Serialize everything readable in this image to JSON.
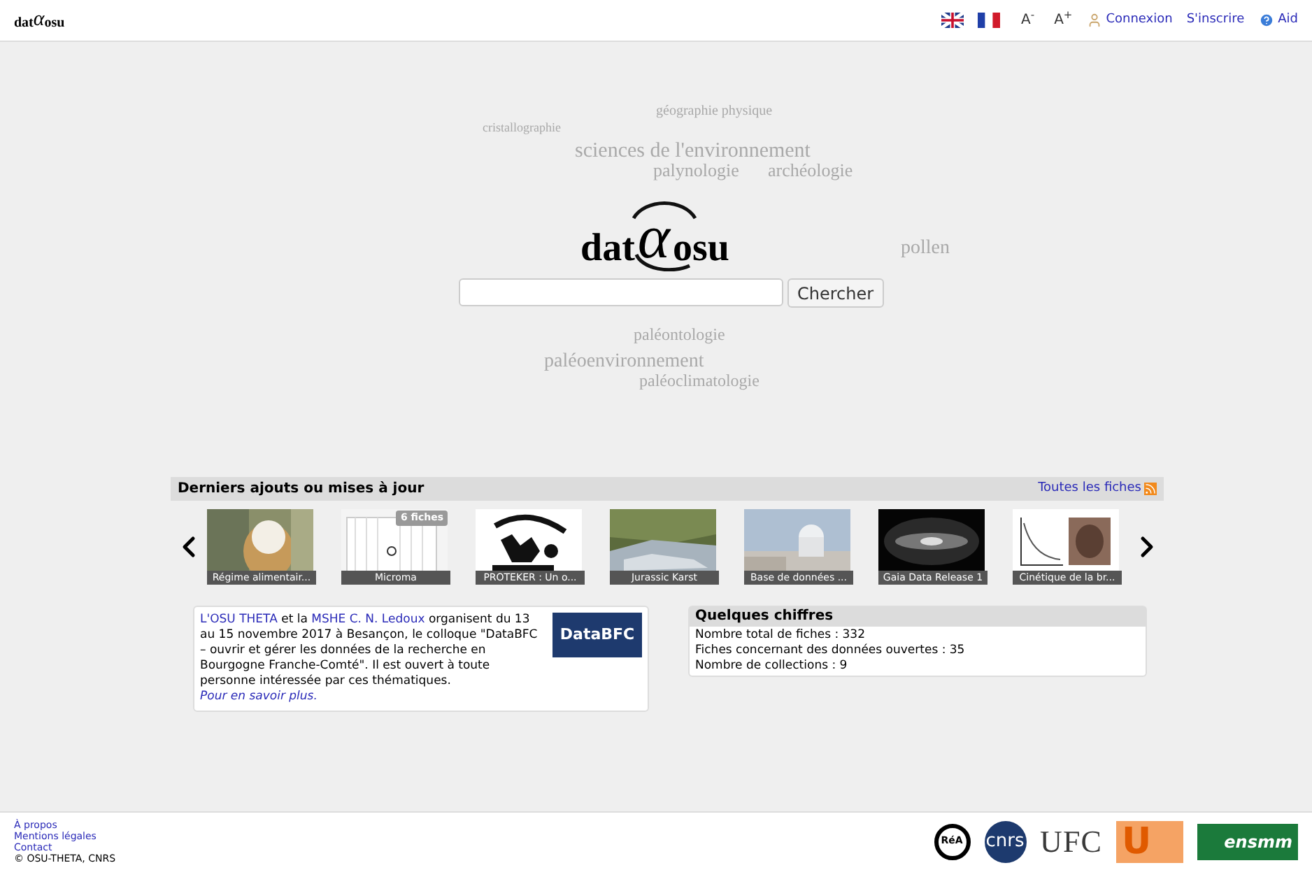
{
  "header": {
    "logo": {
      "left": "dat",
      "mark": "α",
      "right": "osu"
    },
    "languages": [
      {
        "kind": "uk"
      },
      {
        "kind": "fr"
      }
    ],
    "font_buttons": [
      "A$^{-}$",
      "A$^{+}$"
    ],
    "links": [
      {
        "kind": "login",
        "label": "Connexion"
      },
      {
        "kind": "signup",
        "label": "S'inscrire"
      },
      {
        "kind": "help",
        "label": "Aid"
      }
    ]
  },
  "cloud": {
    "words": [
      "sciences de l'environnement",
      "palynologie",
      "archéologie",
      "géographie physique",
      "cristallographie",
      "pollen",
      "paléontologie",
      "paléoenvironnement",
      "paléoclimatologie"
    ]
  },
  "logo": {
    "left": "dat",
    "mark": "α",
    "right": "osu"
  },
  "search": {
    "button": "Chercher"
  },
  "latest": {
    "title": "Derniers ajouts ou mises à jour",
    "all_link": "Toutes les fiches",
    "items": [
      {
        "caption": "Régime alimentair...",
        "kind": "owl"
      },
      {
        "caption": "Microma",
        "kind": "collection",
        "badge": "6 fiches"
      },
      {
        "caption": "PROTEKER : Un o...",
        "kind": "logo"
      },
      {
        "caption": "Jurassic Karst",
        "kind": "river"
      },
      {
        "caption": "Base de données ...",
        "kind": "observatory"
      },
      {
        "caption": "Gaia Data Release 1",
        "kind": "galaxy"
      },
      {
        "caption": "Cinétique de la br...",
        "kind": "chart"
      }
    ]
  },
  "news": {
    "segments": [
      {
        "text": "L'OSU THETA",
        "kind": "link"
      },
      {
        "text": " et la ",
        "kind": "text"
      },
      {
        "text": "MSHE C. N. Ledoux",
        "kind": "link"
      },
      {
        "text": " organisent du 13 au 15 novembre 2017 à Besançon, le colloque \"DataBFC – ouvrir et gérer les données de la recherche en Bourgogne Franche-Comté\". Il est ouvert à toute personne intéressée par ces thématiques. ",
        "kind": "text"
      },
      {
        "text": "Pour en savoir plus.",
        "kind": "italic-link"
      }
    ],
    "banner": "DataBFC"
  },
  "stats": {
    "title": "Quelques chiffres",
    "lines": [
      "Nombre total de fiches : 332",
      "Fiches concernant des données ouvertes : 35",
      "Nombre de collections : 9"
    ]
  },
  "footer": {
    "links": [
      "À propos",
      "Mentions légales",
      "Contact"
    ],
    "copyright": "© OSU-THETA, CNRS",
    "partners": [
      {
        "kind": "circle",
        "label": "RéA"
      },
      {
        "kind": "cnrs",
        "label": "cnrs"
      },
      {
        "kind": "ufc",
        "label": "UFC"
      },
      {
        "kind": "ub",
        "label": "U"
      },
      {
        "kind": "ensmm",
        "label": "ensmm"
      }
    ]
  }
}
